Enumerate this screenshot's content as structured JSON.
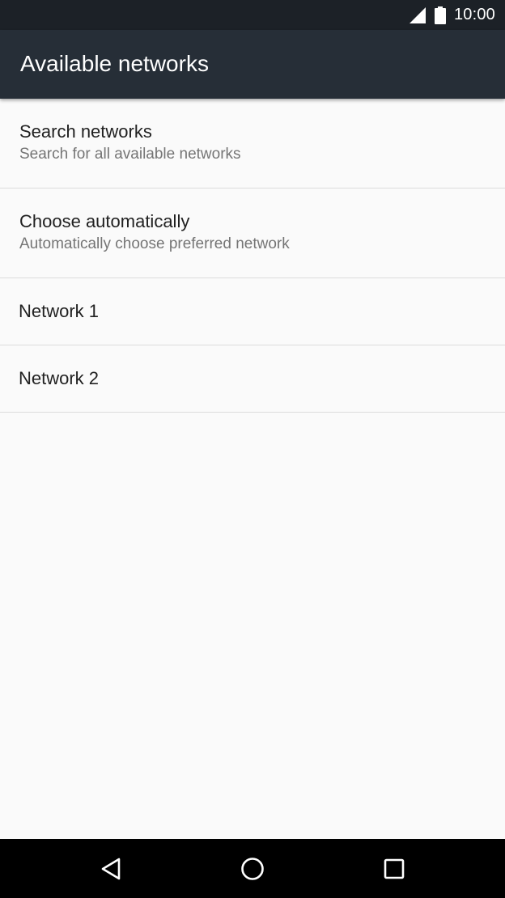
{
  "status_bar": {
    "time": "10:00",
    "icons": [
      "signal-icon",
      "battery-icon"
    ]
  },
  "app_bar": {
    "title": "Available networks"
  },
  "preferences": [
    {
      "title": "Search networks",
      "summary": "Search for all available networks"
    },
    {
      "title": "Choose automatically",
      "summary": "Automatically choose preferred network"
    },
    {
      "title": "Network 1"
    },
    {
      "title": "Network 2"
    }
  ],
  "nav_bar": {
    "buttons": [
      "back-icon",
      "home-icon",
      "recents-icon"
    ]
  },
  "colors": {
    "status_bar": "#1c2127",
    "app_bar": "#262e37",
    "background": "#fafafa",
    "divider": "#dcdcdc",
    "primary_text": "#212121",
    "secondary_text": "#757575",
    "nav_bar": "#000000"
  }
}
